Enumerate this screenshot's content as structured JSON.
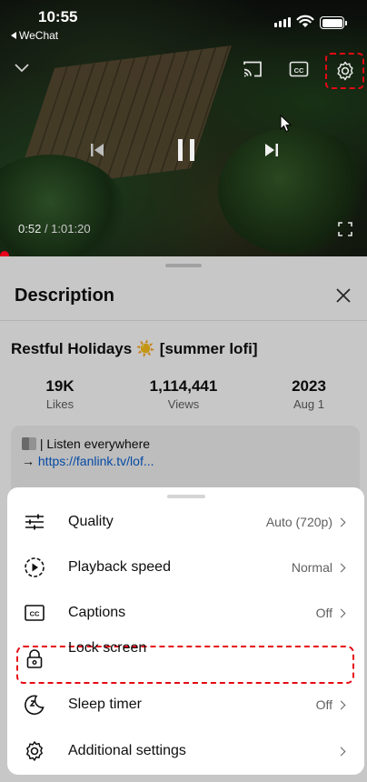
{
  "status_bar": {
    "time": "10:55",
    "back_app": "WeChat"
  },
  "player": {
    "current_time": "0:52",
    "duration": "1:01:20",
    "icons": [
      "chevron-down-icon",
      "cast-icon",
      "captions-icon",
      "settings-gear-icon",
      "previous-icon",
      "pause-icon",
      "next-icon",
      "fullscreen-icon"
    ]
  },
  "description": {
    "heading": "Description",
    "video_title": "Restful Holidays ☀️ [summer lofi]",
    "stats": [
      {
        "value": "19K",
        "label": "Likes"
      },
      {
        "value": "1,114,441",
        "label": "Views"
      },
      {
        "value": "2023",
        "label": "Aug 1"
      }
    ],
    "info_line1": "| Listen everywhere",
    "info_arrow": "→ ",
    "info_link": "https://fanlink.tv/lof..."
  },
  "settings_sheet": {
    "rows": [
      {
        "label": "Quality",
        "value": "Auto (720p)",
        "icon": "quality-sliders-icon"
      },
      {
        "label": "Playback speed",
        "value": "Normal",
        "icon": "playback-speed-icon"
      },
      {
        "label": "Captions",
        "value": "Off",
        "icon": "captions-icon"
      },
      {
        "label": "Lock screen",
        "value": "",
        "icon": "lock-icon"
      },
      {
        "label": "Sleep timer",
        "value": "Off",
        "icon": "sleep-timer-icon"
      },
      {
        "label": "Additional settings",
        "value": "",
        "icon": "gear-icon"
      }
    ]
  },
  "colors": {
    "highlight": "#e50914",
    "link": "#065fd4",
    "progress": "#e6001c"
  }
}
